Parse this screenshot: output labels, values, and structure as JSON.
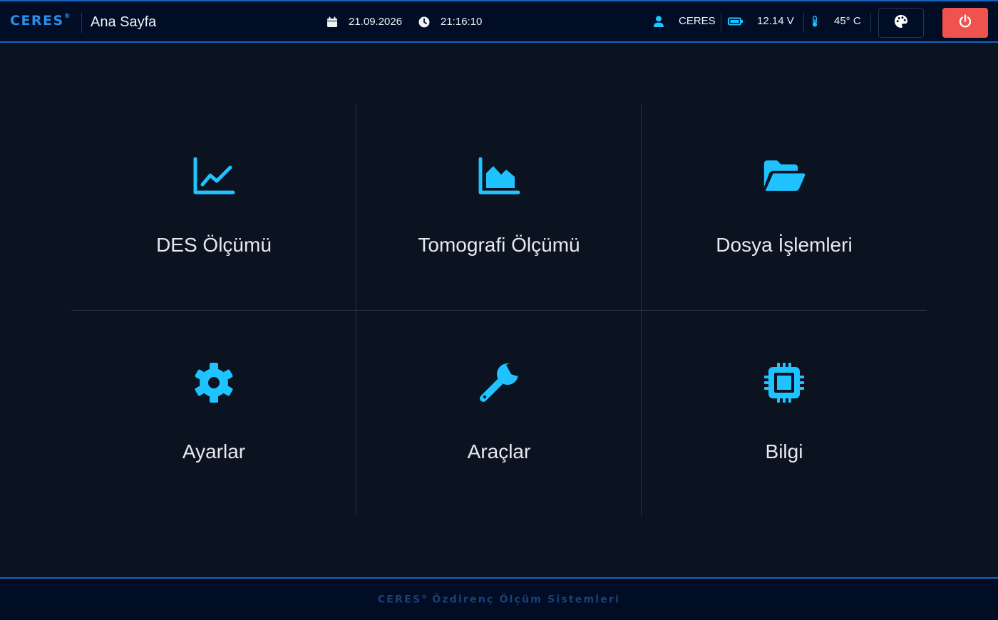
{
  "header": {
    "brand": "CERES",
    "brand_mark": "®",
    "page_title": "Ana Sayfa",
    "date": "21.09.2026",
    "time": "21:16:10",
    "user": "CERES",
    "voltage": "12.14 V",
    "temperature": "45° C",
    "icons": {
      "date": "calendar-icon",
      "time": "clock-icon",
      "user": "user-icon",
      "voltage": "battery-icon",
      "temperature": "thermometer-icon",
      "theme": "palette-icon",
      "power": "power-icon"
    }
  },
  "tiles": [
    {
      "label": "DES Ölçümü",
      "icon": "line-chart-icon"
    },
    {
      "label": "Tomografi Ölçümü",
      "icon": "area-chart-icon"
    },
    {
      "label": "Dosya İşlemleri",
      "icon": "folder-open-icon"
    },
    {
      "label": "Ayarlar",
      "icon": "gear-icon"
    },
    {
      "label": "Araçlar",
      "icon": "wrench-icon"
    },
    {
      "label": "Bilgi",
      "icon": "microchip-icon"
    }
  ],
  "footer": {
    "brand": "CERES",
    "brand_mark": "®",
    "subtitle": "Özdirenç Ölçüm Sistemleri"
  },
  "colors": {
    "accent": "#1ec3ff",
    "brand": "#2a8fe6",
    "border_blue": "#1565c0",
    "header_bg": "#000d24",
    "page_bg": "#0b1220",
    "power_button": "#ef5350"
  }
}
